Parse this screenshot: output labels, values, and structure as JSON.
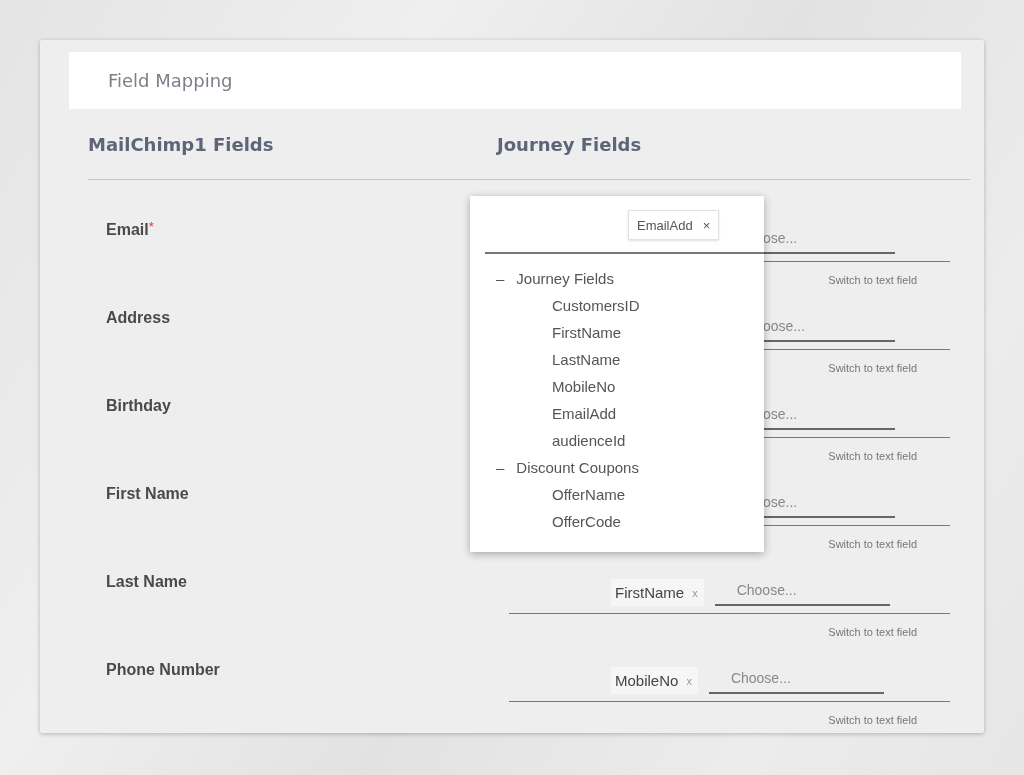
{
  "header": {
    "title": "Field Mapping"
  },
  "columns": [
    "MailChimp1 Fields",
    "Journey Fields"
  ],
  "rows": [
    {
      "label": "Email",
      "mark": "*",
      "choose": "ose...",
      "cut": true,
      "switch_link": "Switch to text field"
    },
    {
      "label": "Address",
      "choose": "oose...",
      "cut": true,
      "switch_link": "Switch to text field"
    },
    {
      "label": "Birthday",
      "choose": "ose...",
      "cut": true,
      "switch_link": "Switch to text field"
    },
    {
      "label": "First Name",
      "choose": "ose...",
      "cut": true,
      "switch_link": "Switch to text field"
    },
    {
      "label": "Last Name",
      "chip": {
        "label": "FirstName",
        "remove": "x"
      },
      "choose": "Choose...",
      "cut": false,
      "switch_link": "Switch to text field"
    },
    {
      "label": "Phone Number",
      "chip": {
        "label": "MobileNo",
        "remove": "x"
      },
      "choose": "Choose...",
      "cut": false,
      "switch_link": "Switch to text field"
    }
  ],
  "dropdown": {
    "chips": [
      {
        "label": "EmailAdd",
        "remove": "×"
      }
    ],
    "groups": [
      {
        "label": "Journey Fields",
        "toggle": "–",
        "expanded": true,
        "children": [
          {
            "label": "CustomersID"
          },
          {
            "label": "FirstName"
          },
          {
            "label": "LastName"
          },
          {
            "label": "MobileNo"
          },
          {
            "label": "EmailAdd"
          },
          {
            "label": "audienceId"
          }
        ]
      },
      {
        "label": "Discount Coupons",
        "toggle": "–",
        "expanded": true,
        "children": [
          {
            "label": "OfferName"
          },
          {
            "label": "OfferCode"
          }
        ]
      }
    ]
  }
}
